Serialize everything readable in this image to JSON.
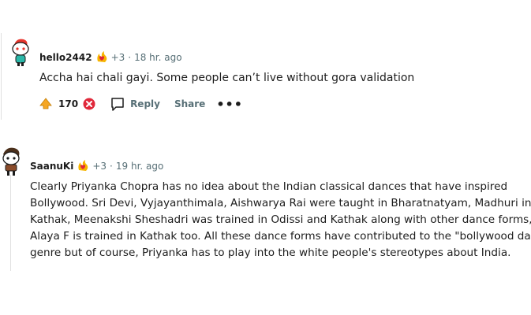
{
  "comments": [
    {
      "username": "hello2442",
      "flair_icon": "flame-heart-icon",
      "karma": "+3",
      "separator": "·",
      "time": "18 hr. ago",
      "text": "Accha hai chali gayi. Some people can’t live without gora validation",
      "votes": "170",
      "reply_label": "Reply",
      "share_label": "Share",
      "more_label": "•••"
    },
    {
      "username": "SaanuKi",
      "flair_icon": "flame-heart-icon",
      "karma": "+3",
      "separator": "·",
      "time": "19 hr. ago",
      "text_lines": [
        "Clearly Priyanka Chopra has no idea about the Indian classical dances that have inspired",
        "Bollywood. Sri Devi, Vyjayanthimala, Aishwarya Rai were taught in Bharatnatyam, Madhuri in",
        "Kathak, Meenakshi Sheshadri was trained in Odissi and Kathak along with other dance forms,",
        "Alaya F is trained in Kathak too. All these dance forms have contributed to the \"bollywood dance\"",
        "genre but of course, Priyanka has to play into the white people's stereotypes about India."
      ]
    }
  ],
  "colors": {
    "upvote": "#f5a623",
    "downvote": "#e0283a",
    "meta": "#576f76"
  }
}
